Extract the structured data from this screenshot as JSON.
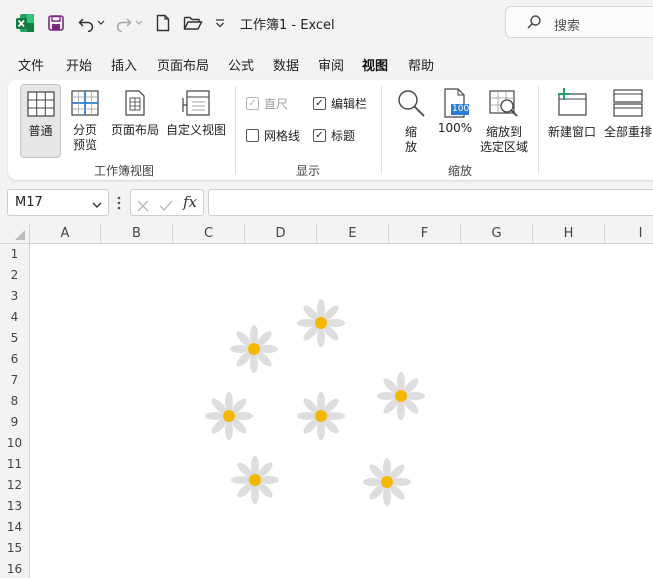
{
  "titlebar": {
    "title": "工作簿1  -  Excel",
    "search_placeholder": "搜索",
    "icons": [
      "excel-logo-icon",
      "save-icon",
      "undo-icon",
      "redo-icon",
      "new-file-icon",
      "open-folder-icon",
      "customize-qat-icon",
      "search-icon"
    ]
  },
  "menu": {
    "items": [
      "文件",
      "开始",
      "插入",
      "页面布局",
      "公式",
      "数据",
      "审阅",
      "视图",
      "帮助"
    ],
    "active": "视图"
  },
  "ribbon": {
    "workbook_views": {
      "label": "工作簿视图",
      "normal": "普通",
      "page_break_line1": "分页",
      "page_break_line2": "预览",
      "page_layout": "页面布局",
      "custom_view": "自定义视图"
    },
    "show": {
      "label": "显示",
      "ruler": "直尺",
      "formula_bar": "编辑栏",
      "gridlines": "网格线",
      "headings": "标题"
    },
    "zoom": {
      "label": "缩放",
      "zoom_line1": "缩",
      "zoom_line2": "放",
      "zoom_100": "100%",
      "zoom_100_icon_text": "100",
      "zoom_sel_line1": "缩放到",
      "zoom_sel_line2": "选定区域"
    },
    "window": {
      "new_window": "新建窗口",
      "arrange_all": "全部重排"
    }
  },
  "formula_bar": {
    "name_box": "M17",
    "fx_label": "fx",
    "value": ""
  },
  "grid": {
    "columns": [
      "A",
      "B",
      "C",
      "D",
      "E",
      "F",
      "G",
      "H",
      "I"
    ],
    "rows": [
      "1",
      "2",
      "3",
      "4",
      "5",
      "6",
      "7",
      "8",
      "9",
      "10",
      "11",
      "12",
      "13",
      "14",
      "15",
      "16"
    ],
    "flower_count": 7
  }
}
